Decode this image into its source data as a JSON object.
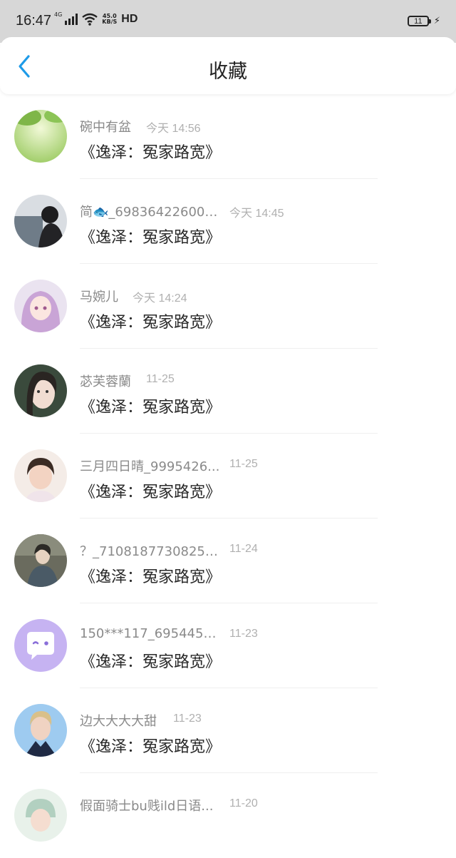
{
  "status_bar": {
    "time": "16:47",
    "network": "4G",
    "net_speed_top": "45.0",
    "net_speed_bottom": "KB/S",
    "hd": "HD",
    "battery": "11"
  },
  "header": {
    "title": "收藏",
    "back_icon": "chevron-left-icon",
    "accent": "#1e9be8"
  },
  "items": [
    {
      "name": "碗中有盆",
      "time": "今天 14:56",
      "content": "《逸泽：冤家路宽》"
    },
    {
      "name": "简🐟_698364226004...",
      "time": "今天 14:45",
      "content": "《逸泽：冤家路宽》"
    },
    {
      "name": "马婉儿",
      "time": "今天 14:24",
      "content": "《逸泽：冤家路宽》"
    },
    {
      "name": "苾芙蓉蘭",
      "time": "11-25",
      "content": "《逸泽：冤家路宽》"
    },
    {
      "name": "三月四日晴_9995426...",
      "time": "11-25",
      "content": "《逸泽：冤家路宽》"
    },
    {
      "name": "？_71081877308255...",
      "time": "11-24",
      "content": "《逸泽：冤家路宽》"
    },
    {
      "name": "150***117_6954451...",
      "time": "11-23",
      "content": "《逸泽：冤家路宽》"
    },
    {
      "name": "边大大大大甜",
      "time": "11-23",
      "content": "《逸泽：冤家路宽》"
    },
    {
      "name": "假面骑士bu贱ild日语...",
      "time": "11-20",
      "content": ""
    }
  ]
}
